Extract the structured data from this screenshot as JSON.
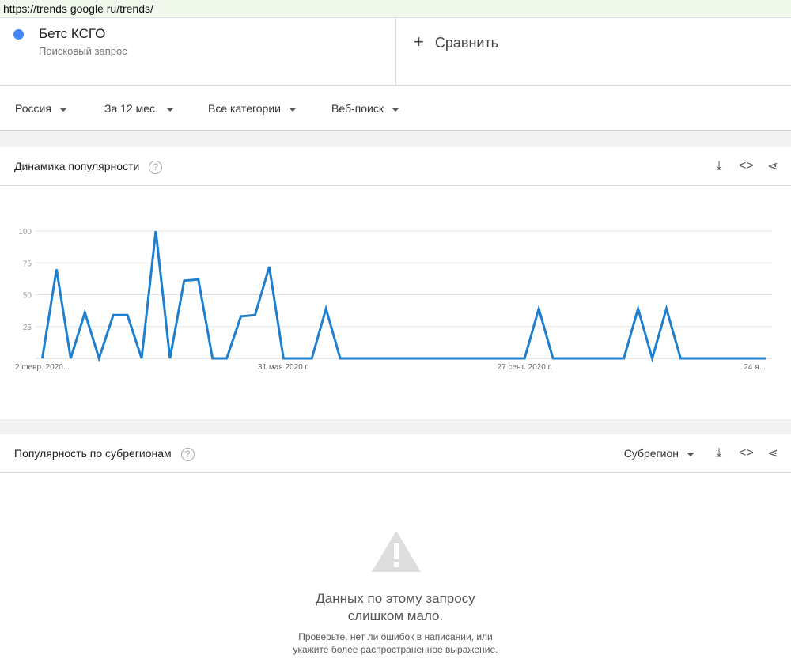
{
  "url": "https://trends google ru/trends/",
  "term": {
    "name": "Бетс КСГО",
    "type": "Поисковый запрос",
    "color": "#4285f4"
  },
  "compare_label": "Сравнить",
  "filters": [
    "Россия",
    "За 12 мес.",
    "Все категории",
    "Веб-поиск"
  ],
  "interest": {
    "title": "Динамика популярности"
  },
  "chart_data": {
    "type": "line",
    "title": "Динамика популярности",
    "ylim": [
      0,
      100
    ],
    "yticks": [
      25,
      50,
      75,
      100
    ],
    "xtick_labels": [
      {
        "index": 0,
        "label": "2 февр. 2020..."
      },
      {
        "index": 17,
        "label": "31 мая 2020 г."
      },
      {
        "index": 34,
        "label": "27 сент. 2020 г."
      },
      {
        "index": 51,
        "label": "24 я..."
      }
    ],
    "series": [
      {
        "name": "Бетс КСГО",
        "color": "#1f7fcf",
        "values": [
          0,
          70,
          0,
          36,
          0,
          34,
          34,
          0,
          100,
          0,
          61,
          62,
          0,
          0,
          33,
          34,
          72,
          0,
          0,
          0,
          39,
          0,
          0,
          0,
          0,
          0,
          0,
          0,
          0,
          0,
          0,
          0,
          0,
          0,
          0,
          39,
          0,
          0,
          0,
          0,
          0,
          0,
          39,
          0,
          39,
          0,
          0,
          0,
          0,
          0,
          0,
          0
        ]
      }
    ]
  },
  "region": {
    "title": "Популярность по субрегионам",
    "select": "Субрегион",
    "empty_title1": "Данных по этому запросу",
    "empty_title2": "слишком мало.",
    "empty_text1": "Проверьте, нет ли ошибок в написании, или",
    "empty_text2": "укажите более распространенное выражение."
  }
}
